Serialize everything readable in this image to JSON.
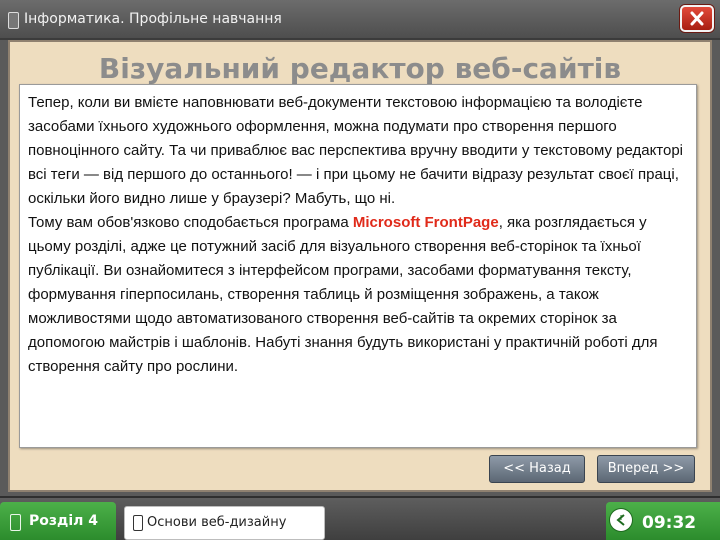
{
  "window": {
    "title": "Інформатика. Профільне навчання",
    "close_icon": "close-x-icon",
    "app_icon": "window-icon"
  },
  "main": {
    "heading": "Візуальний редактор веб-сайтів",
    "paragraph1": "Тепер, коли ви вмієте наповнювати веб-документи текстовою інформацією та володієте засобами їхнього художнього оформлення, можна подумати про створення першого повноцінного сайту. Та чи приваблює вас перспектива вручну вводити у текстовому редакторі всі теги — від першого до останнього! — і при цьому не бачити відразу результат своєї праці, оскільки його видно лише у браузері? Мабуть, що ні.",
    "paragraph2_before": "Тому вам обов'язково сподобається програма ",
    "paragraph2_highlight": "Microsoft FrontPage",
    "paragraph2_after": ", яка розглядається у цьому розділі, адже це потужний засіб для візуального створення веб-сторінок та їхньої публікації. Ви ознайомитеся з інтерфейсом програми, засобами форматування тексту, формування гіперпосилань, створення таблиць й розміщення зображень, а також можливостями щодо автоматизованого створення веб-сайтів та окремих сторінок за допомогою майстрів і шаблонів. Набуті знання будуть використані у практичній роботі для створення сайту про рослини.",
    "highlight_color": "#e02a1a"
  },
  "navigation": {
    "back_label": "<< Назад",
    "forward_label": "Вперед >>"
  },
  "footer": {
    "section_label": "Розділ 4",
    "topic_label": "Основи веб-дизайну",
    "time": "09:32",
    "clock_icon": "clock-icon",
    "accent_color": "#3a9e3a"
  }
}
